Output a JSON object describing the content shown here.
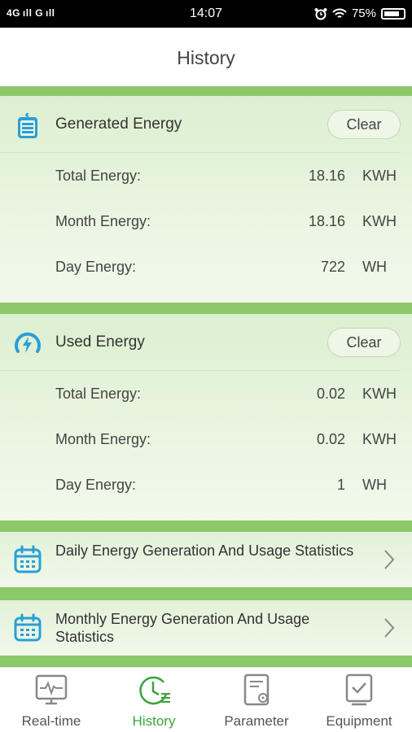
{
  "status_bar": {
    "left": "4G ıll G ıll",
    "time": "14:07",
    "battery": "75%",
    "icons": [
      "alarm-icon",
      "wifi-icon",
      "battery-icon"
    ]
  },
  "header": {
    "title": "History"
  },
  "generated": {
    "title": "Generated Energy",
    "icon": "battery-charging-icon",
    "clear_label": "Clear",
    "rows": [
      {
        "label": "Total Energy:",
        "value": "18.16",
        "unit": "KWH"
      },
      {
        "label": "Month Energy:",
        "value": "18.16",
        "unit": "KWH"
      },
      {
        "label": "Day Energy:",
        "value": "722",
        "unit": "WH"
      }
    ]
  },
  "used": {
    "title": "Used Energy",
    "icon": "power-gauge-icon",
    "clear_label": "Clear",
    "rows": [
      {
        "label": "Total Energy:",
        "value": "0.02",
        "unit": "KWH"
      },
      {
        "label": "Month Energy:",
        "value": "0.02",
        "unit": "KWH"
      },
      {
        "label": "Day Energy:",
        "value": "1",
        "unit": "WH"
      }
    ]
  },
  "stats": [
    {
      "title": "Daily Energy Generation And Usage Statistics",
      "icon": "calendar-icon"
    },
    {
      "title": "Monthly Energy Generation And Usage Statistics",
      "icon": "calendar-icon"
    }
  ],
  "nav": {
    "items": [
      {
        "label": "Real-time",
        "icon": "monitor-icon",
        "active": false
      },
      {
        "label": "History",
        "icon": "clock-icon",
        "active": true
      },
      {
        "label": "Parameter",
        "icon": "document-settings-icon",
        "active": false
      },
      {
        "label": "Equipment",
        "icon": "device-check-icon",
        "active": false
      }
    ]
  },
  "colors": {
    "accent_green": "#3aa43a",
    "divider_green": "#8bc86a",
    "icon_blue": "#2a9fd6",
    "card_bg": "#e9f5e1"
  }
}
